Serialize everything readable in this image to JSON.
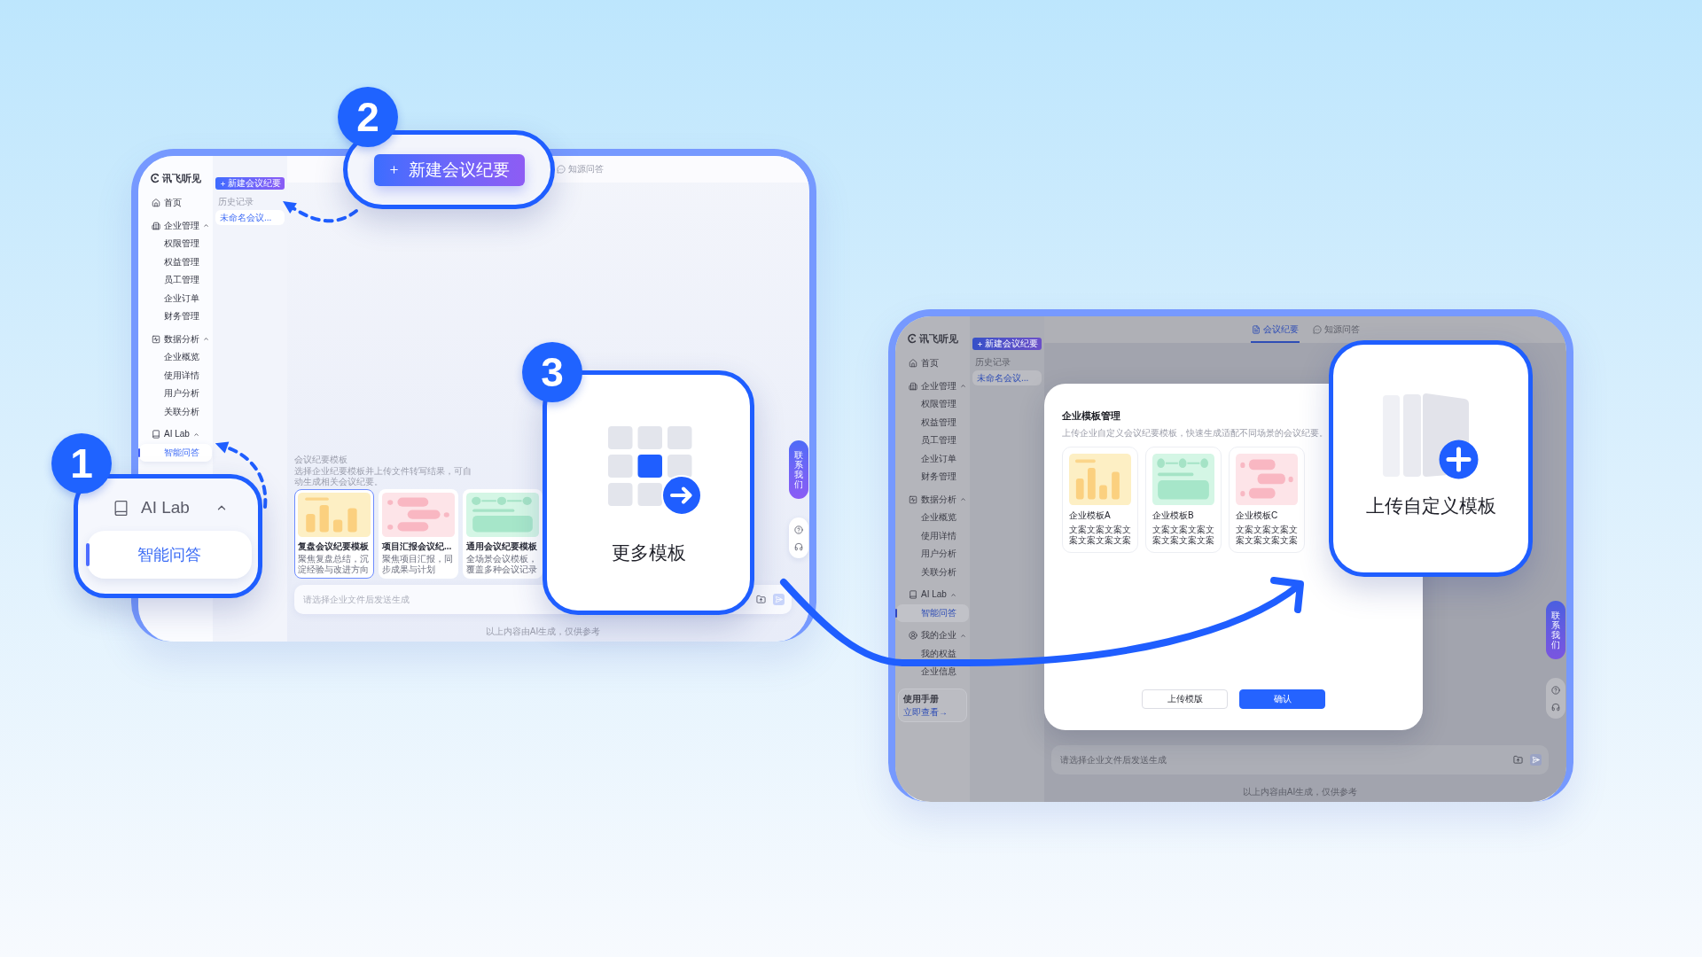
{
  "screens": [
    {
      "dimmed": false,
      "logo": "讯飞听见",
      "nav": [
        {
          "label": "首页",
          "selected": false
        },
        {
          "label": "企业管理",
          "expanded": true,
          "children": [
            {
              "label": "权限管理",
              "selected": false
            },
            {
              "label": "权益管理",
              "selected": false
            },
            {
              "label": "员工管理",
              "selected": false
            },
            {
              "label": "企业订单",
              "selected": false
            },
            {
              "label": "财务管理",
              "selected": false
            }
          ]
        },
        {
          "label": "数据分析",
          "expanded": true,
          "children": [
            {
              "label": "企业概览",
              "selected": false
            },
            {
              "label": "使用详情",
              "selected": false
            },
            {
              "label": "用户分析",
              "selected": false
            },
            {
              "label": "关联分析",
              "selected": false
            }
          ]
        },
        {
          "label": "AI Lab",
          "expanded": true,
          "children": [
            {
              "label": "智能问答",
              "selected": true
            }
          ]
        }
      ],
      "new_button": "新建会议纪要",
      "history_label": "历史记录",
      "history": [
        {
          "label": "未命名会议...",
          "selected": true
        }
      ],
      "tabs": [
        {
          "kind": "chat",
          "label": "知源问答",
          "selected": false
        }
      ],
      "templates": {
        "title": "会议纪要模板",
        "description": "选择企业纪要模板并上传文件转写结果，可自动生成相关会议纪要。",
        "items": [
          {
            "kind": "chart",
            "title": "复盘会议纪要模板",
            "description": "聚焦复盘总结，沉淀经验与改进方向",
            "selected": true
          },
          {
            "kind": "timeline",
            "title": "项目汇报会议纪...",
            "description": "聚焦项目汇报，同步成果与计划",
            "selected": false
          },
          {
            "kind": "board",
            "title": "通用会议纪要模板",
            "description": "全场景会议模板，覆盖多种会议记录",
            "selected": false
          }
        ]
      },
      "input_placeholder": "请选择企业文件后发送生成",
      "footer_note": "以上内容由AI生成，仅供参考",
      "contact": "联系我们"
    },
    {
      "dimmed": true,
      "logo": "讯飞听见",
      "nav": [
        {
          "label": "首页",
          "selected": false
        },
        {
          "label": "企业管理",
          "expanded": true,
          "children": [
            {
              "label": "权限管理",
              "selected": false
            },
            {
              "label": "权益管理",
              "selected": false
            },
            {
              "label": "员工管理",
              "selected": false
            },
            {
              "label": "企业订单",
              "selected": false
            },
            {
              "label": "财务管理",
              "selected": false
            }
          ]
        },
        {
          "label": "数据分析",
          "expanded": true,
          "children": [
            {
              "label": "企业概览",
              "selected": false
            },
            {
              "label": "使用详情",
              "selected": false
            },
            {
              "label": "用户分析",
              "selected": false
            },
            {
              "label": "关联分析",
              "selected": false
            }
          ]
        },
        {
          "label": "AI Lab",
          "expanded": true,
          "children": [
            {
              "label": "智能问答",
              "selected": true
            }
          ]
        },
        {
          "label": "我的企业",
          "expanded": true,
          "children": [
            {
              "label": "我的权益",
              "selected": false
            },
            {
              "label": "企业信息",
              "selected": false
            }
          ]
        }
      ],
      "manual": {
        "title": "使用手册",
        "link": "立即查看→"
      },
      "new_button": "新建会议纪要",
      "history_label": "历史记录",
      "history": [
        {
          "label": "未命名会议...",
          "selected": true
        }
      ],
      "tabs": [
        {
          "kind": "notes",
          "label": "会议纪要",
          "selected": true
        },
        {
          "kind": "chat",
          "label": "知源问答",
          "selected": false
        }
      ],
      "modal": {
        "title": "企业模板管理",
        "description": "上传企业自定义会议纪要模板，快速生成适配不同场景的会议纪要。",
        "items": [
          {
            "kind": "chart",
            "title": "企业模板A",
            "description": "文案文案文案文案文案文案文案"
          },
          {
            "kind": "board",
            "title": "企业模板B",
            "description": "文案文案文案文案文案文案文案"
          },
          {
            "kind": "timeline",
            "title": "企业模板C",
            "description": "文案文案文案文案文案文案文案"
          }
        ],
        "buttons": [
          {
            "kind": "secondary",
            "label": "上传模版"
          },
          {
            "kind": "primary",
            "label": "确认"
          }
        ]
      },
      "input_placeholder": "请选择企业文件后发送生成",
      "footer_note": "以上内容由AI生成，仅供参考",
      "contact": "联系我们"
    }
  ],
  "callouts": [
    {
      "number": "1",
      "kind": "nav",
      "group": {
        "label": "AI Lab",
        "expanded": true
      },
      "item": {
        "label": "智能问答",
        "selected": true
      }
    },
    {
      "number": "2",
      "kind": "button",
      "label": "新建会议纪要"
    },
    {
      "number": "3",
      "kind": "more",
      "label": "更多模板"
    },
    {
      "kind": "upload",
      "label": "上传自定义模板"
    }
  ]
}
